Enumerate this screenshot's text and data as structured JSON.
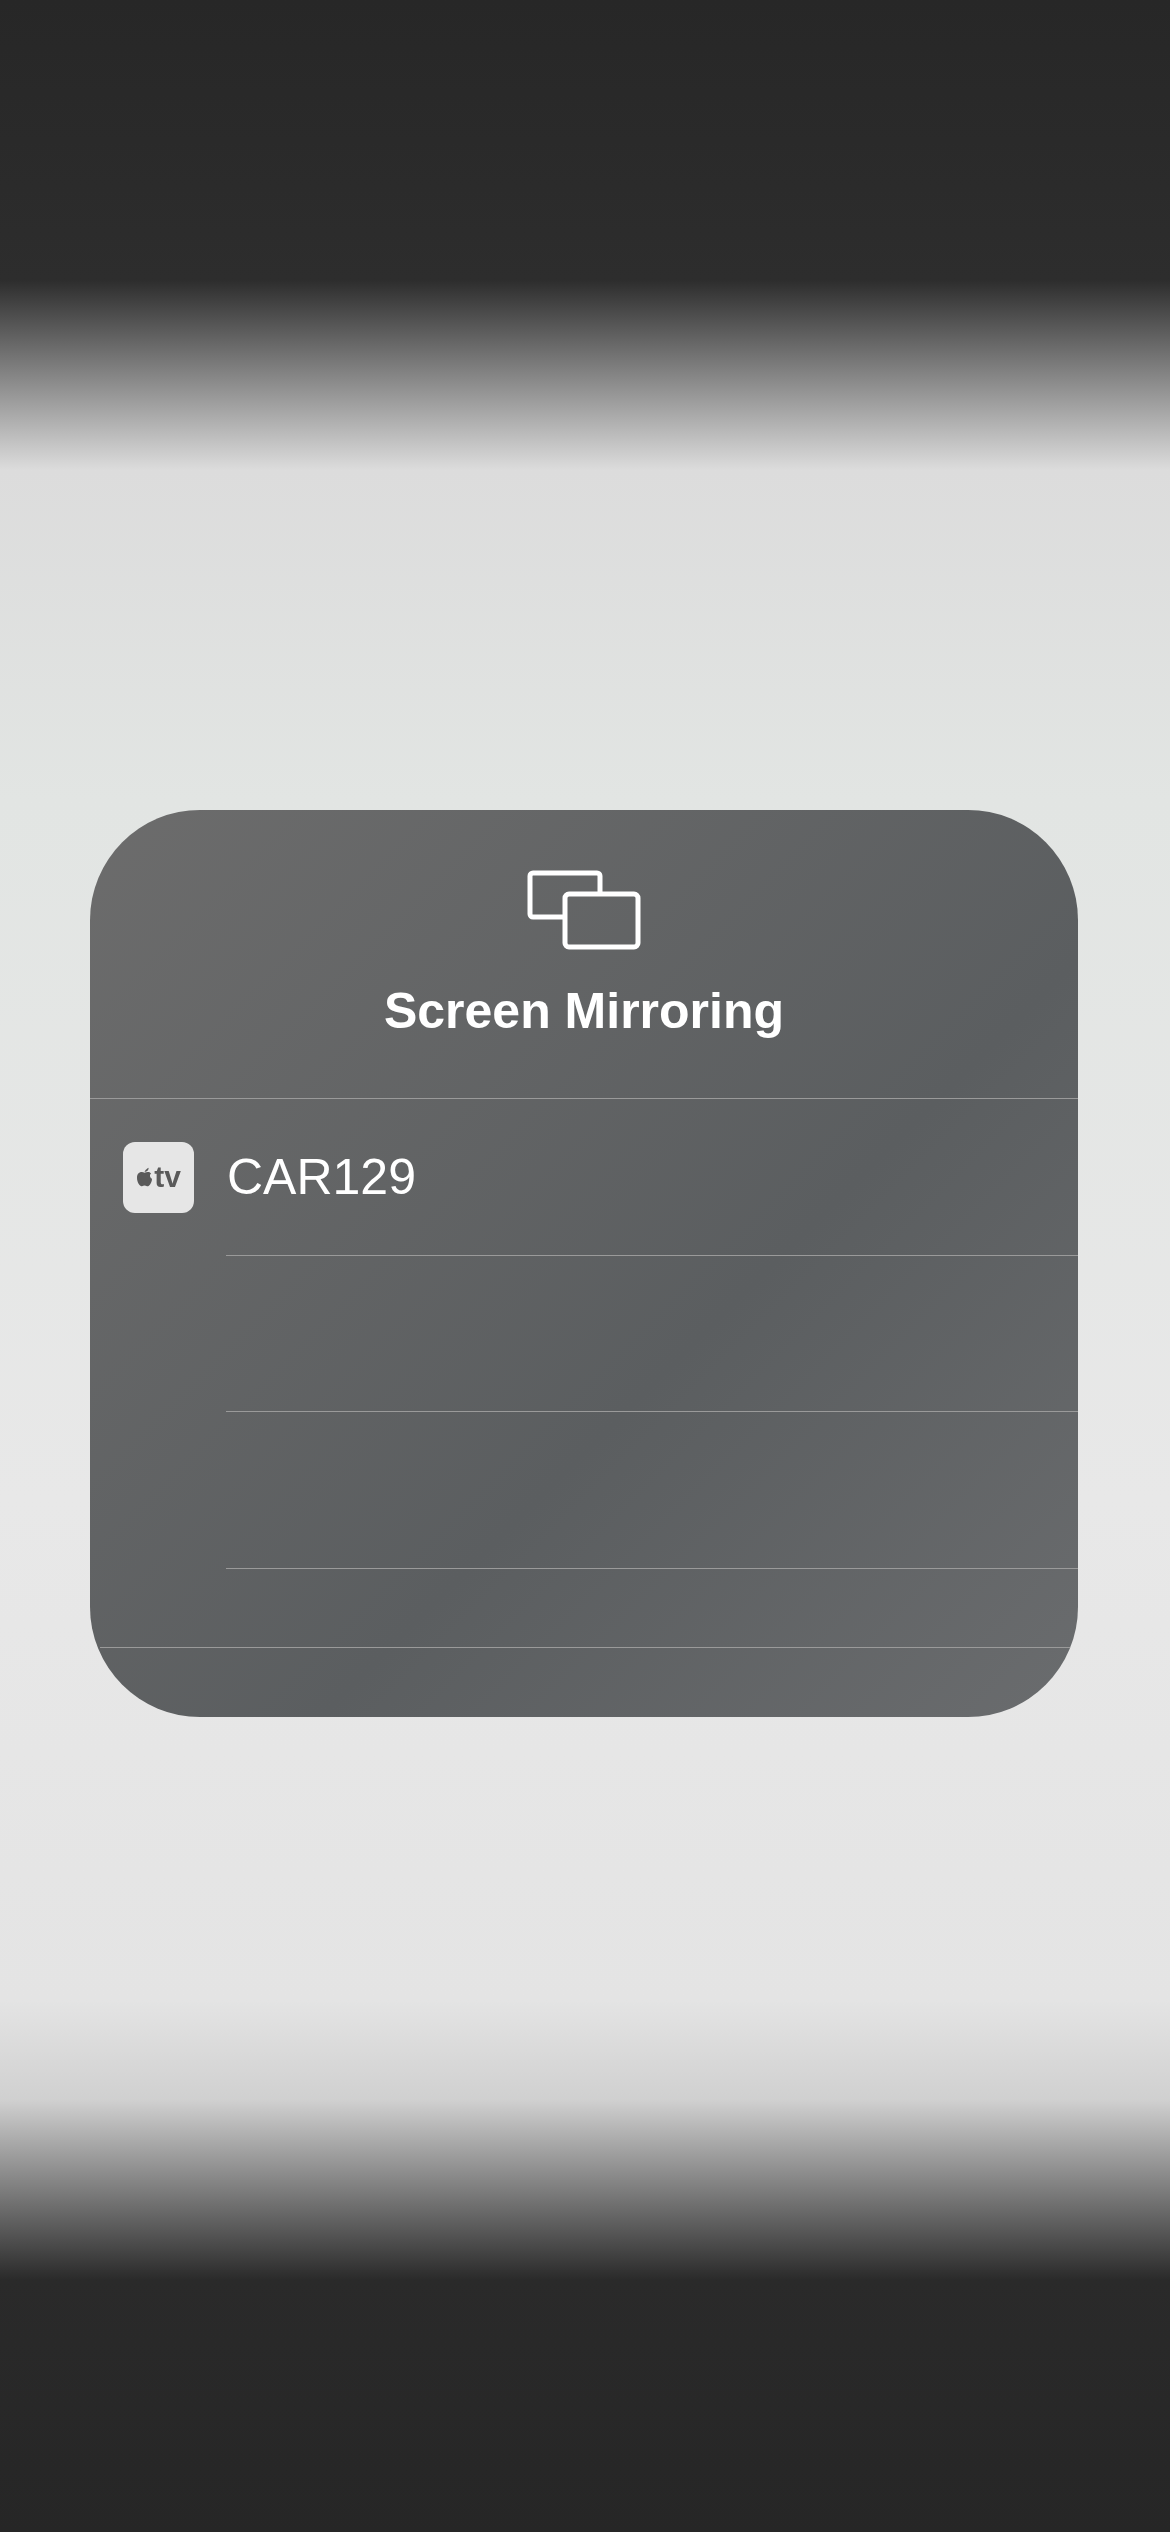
{
  "panel": {
    "title": "Screen Mirroring"
  },
  "devices": [
    {
      "badge": "tv",
      "name": "CAR129"
    }
  ]
}
